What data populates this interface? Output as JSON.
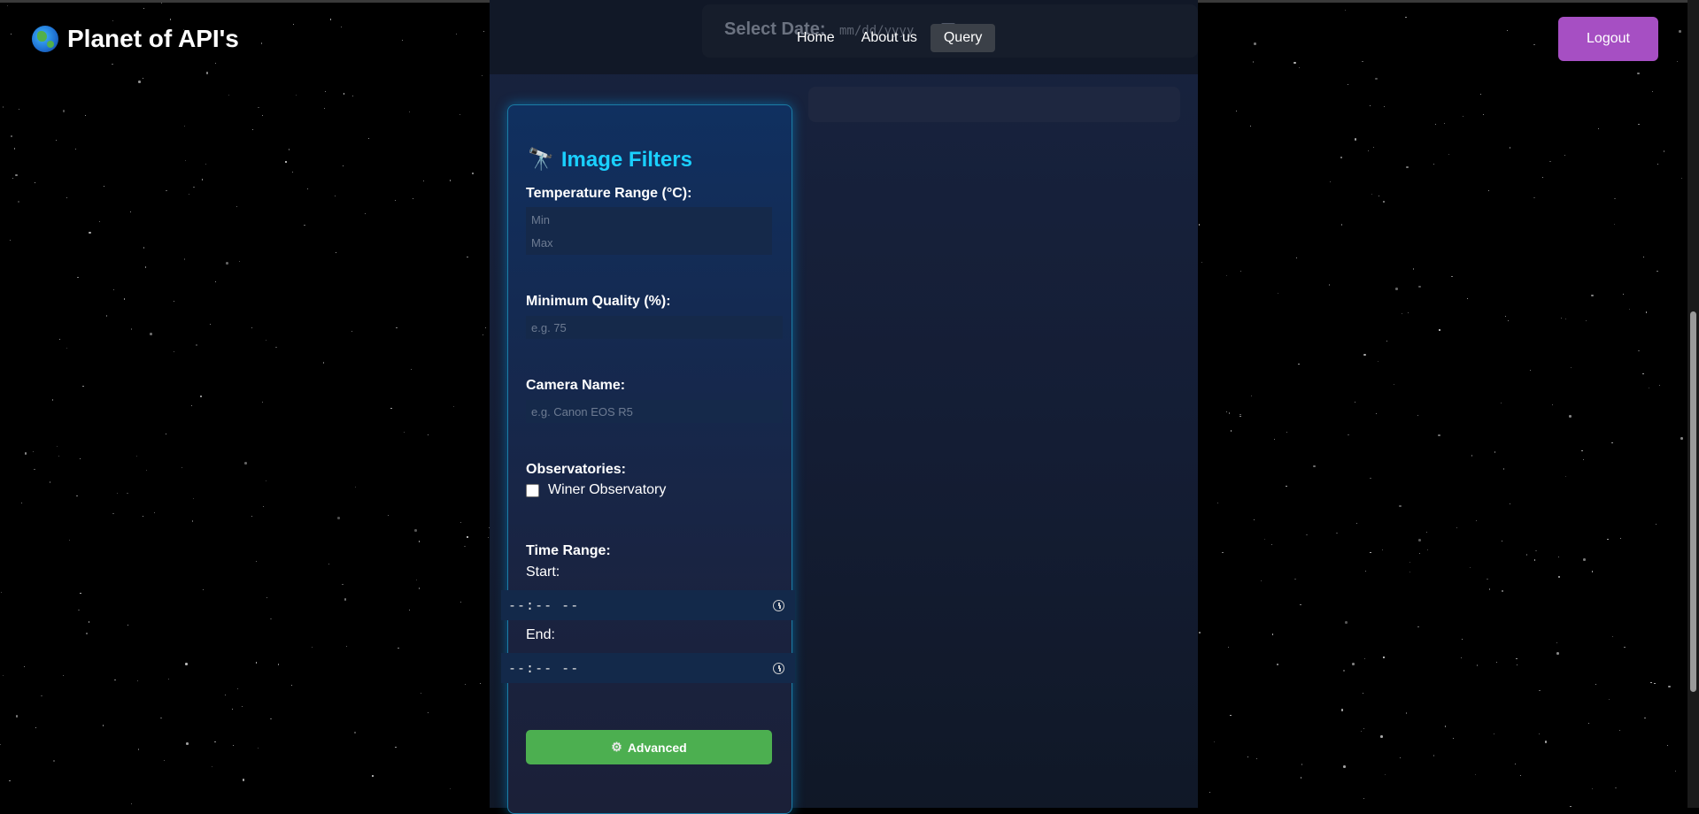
{
  "brand": {
    "title": "Planet of API's",
    "icon": "globe-icon"
  },
  "nav": {
    "items": [
      {
        "label": "Home"
      },
      {
        "label": "About us"
      },
      {
        "label": "Query",
        "active": true
      }
    ]
  },
  "logout_label": "Logout",
  "date": {
    "label": "Select Date:",
    "value": "mm/dd/yyyy"
  },
  "filters": {
    "title": "Image Filters",
    "title_icon": "telescope-icon",
    "temperature": {
      "label": "Temperature Range (°C):",
      "min_placeholder": "Min",
      "max_placeholder": "Max"
    },
    "quality": {
      "label": "Minimum Quality (%):",
      "placeholder": "e.g. 75"
    },
    "camera": {
      "label": "Camera Name:",
      "placeholder": "e.g. Canon EOS R5"
    },
    "observatories": {
      "label": "Observatories:",
      "options": [
        {
          "label": "Winer Observatory",
          "checked": false
        }
      ]
    },
    "time_range": {
      "label": "Time Range:",
      "start_label": "Start:",
      "start_value": "--:-- --",
      "end_label": "End:",
      "end_value": "--:-- --"
    },
    "advanced_label": "Advanced",
    "advanced_icon": "gear-icon"
  },
  "colors": {
    "accent_title": "#1ad0ff",
    "logout_bg": "#a64fc3",
    "advanced_bg": "#4caf50",
    "nav_active_bg": "#3b4048"
  }
}
